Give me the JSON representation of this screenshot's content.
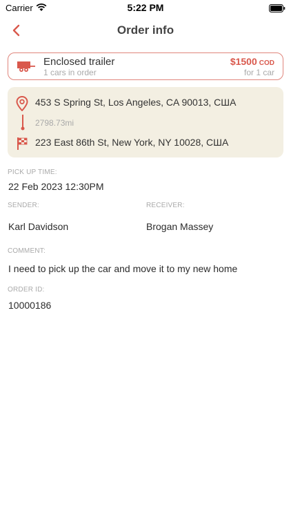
{
  "status_bar": {
    "carrier": "Carrier",
    "time": "5:22 PM"
  },
  "header": {
    "title": "Order info",
    "back_icon": "chevron-left-icon"
  },
  "trailer": {
    "name": "Enclosed trailer",
    "cars": "1 cars in order",
    "price": "$1500",
    "price_type": "COD",
    "price_note": "for 1 car",
    "icon": "trailer-icon"
  },
  "route": {
    "from": "453 S Spring St, Los Angeles, CA 90013, США",
    "distance": "2798.73mi",
    "to": "223 East 86th St, New York, NY 10028, США"
  },
  "details": {
    "pickup_label": "PICK UP TIME:",
    "pickup_value": "22 Feb 2023 12:30PM",
    "sender_label": "SENDER:",
    "sender_value": "Karl Davidson",
    "receiver_label": "RECEIVER:",
    "receiver_value": "Brogan Massey",
    "comment_label": "COMMENT:",
    "comment_value": "I need to pick up the car and move it to my new home",
    "order_id_label": "ORDER ID:",
    "order_id_value": "10000186"
  },
  "colors": {
    "accent": "#d9584c",
    "route_bg": "#f3efe2",
    "muted": "#a9a9a9"
  }
}
